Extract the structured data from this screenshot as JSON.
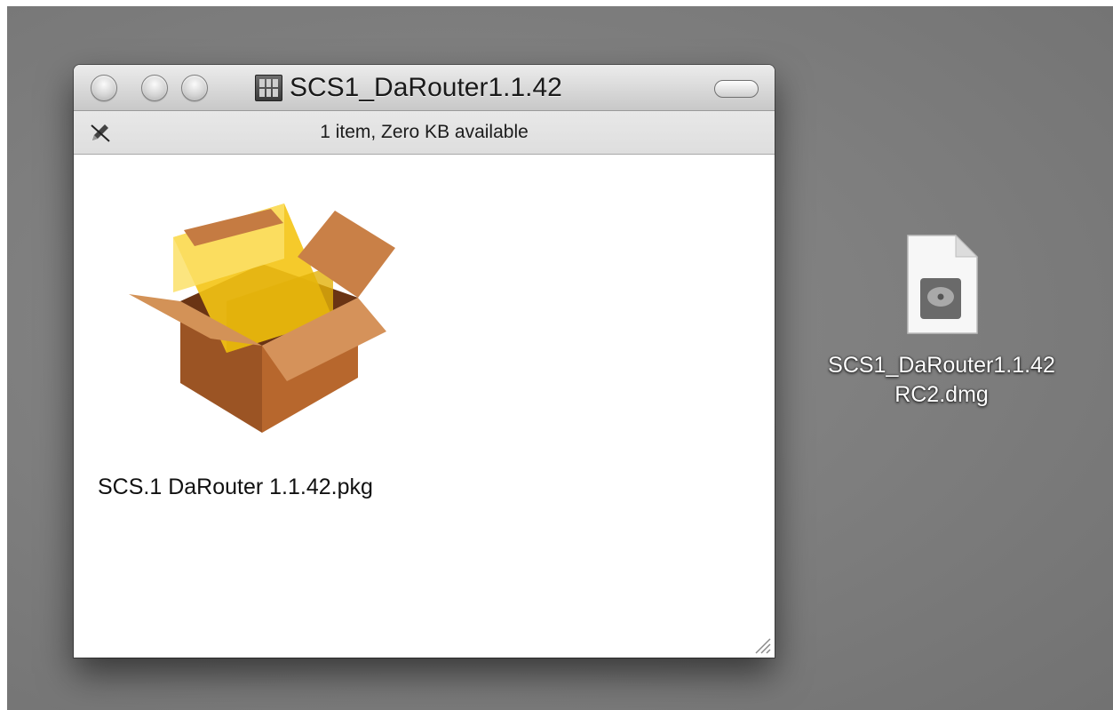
{
  "window": {
    "title": "SCS1_DaRouter1.1.42",
    "status": "1 item, Zero KB available",
    "items": [
      {
        "name": "SCS.1 DaRouter 1.1.42.pkg",
        "icon": "installer-package-icon"
      }
    ]
  },
  "desktop": {
    "items": [
      {
        "line1": "SCS1_DaRouter1.1.42",
        "line2": "RC2.dmg",
        "icon": "disk-image-icon"
      }
    ]
  },
  "colors": {
    "desktop": "#7f7f7f",
    "titlebar": "#d8d8d8",
    "package_box": "#c1743d",
    "package_glass": "#f2c81c"
  }
}
